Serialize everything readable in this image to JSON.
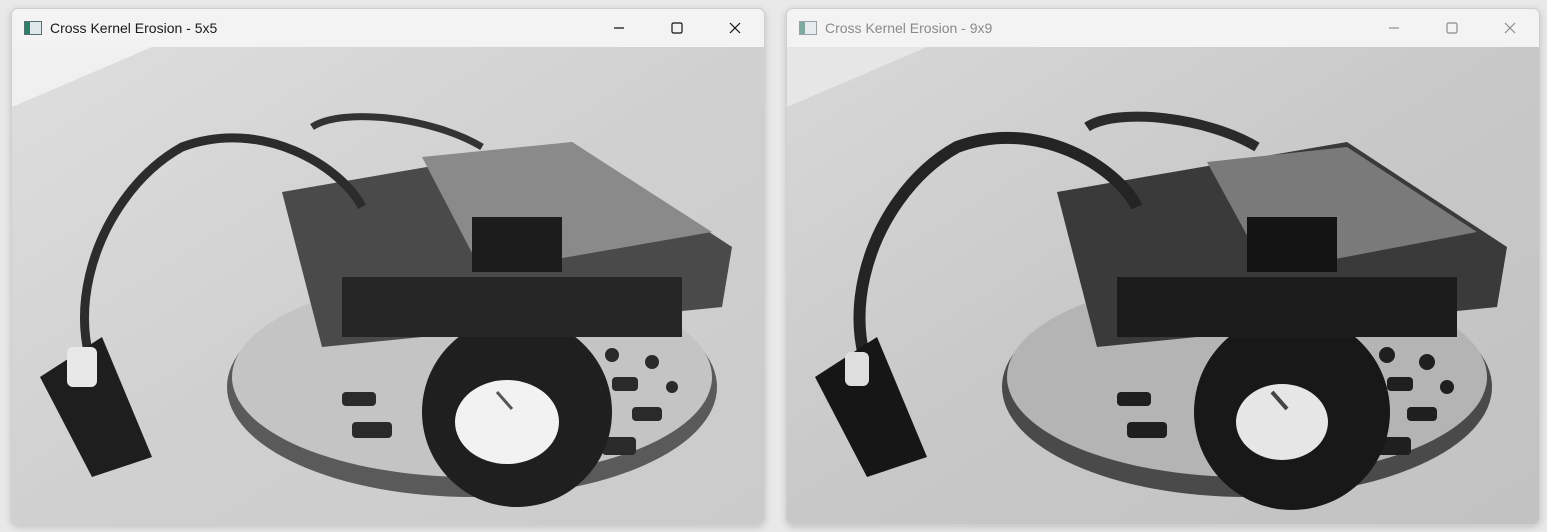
{
  "windows": [
    {
      "title": "Cross Kernel Erosion - 5x5",
      "controls": [
        "minimize-icon",
        "maximize-icon",
        "close-icon"
      ],
      "content": "robot-photo-eroded"
    },
    {
      "title": "Cross Kernel Erosion - 9x9",
      "controls": [
        "minimize-icon",
        "maximize-icon",
        "close-icon"
      ],
      "content": "robot-photo-eroded"
    }
  ],
  "colors": {
    "titlebar": "#f3f3f3",
    "background": "#e9e9e9",
    "inactive_title": "#8a8a8a"
  }
}
